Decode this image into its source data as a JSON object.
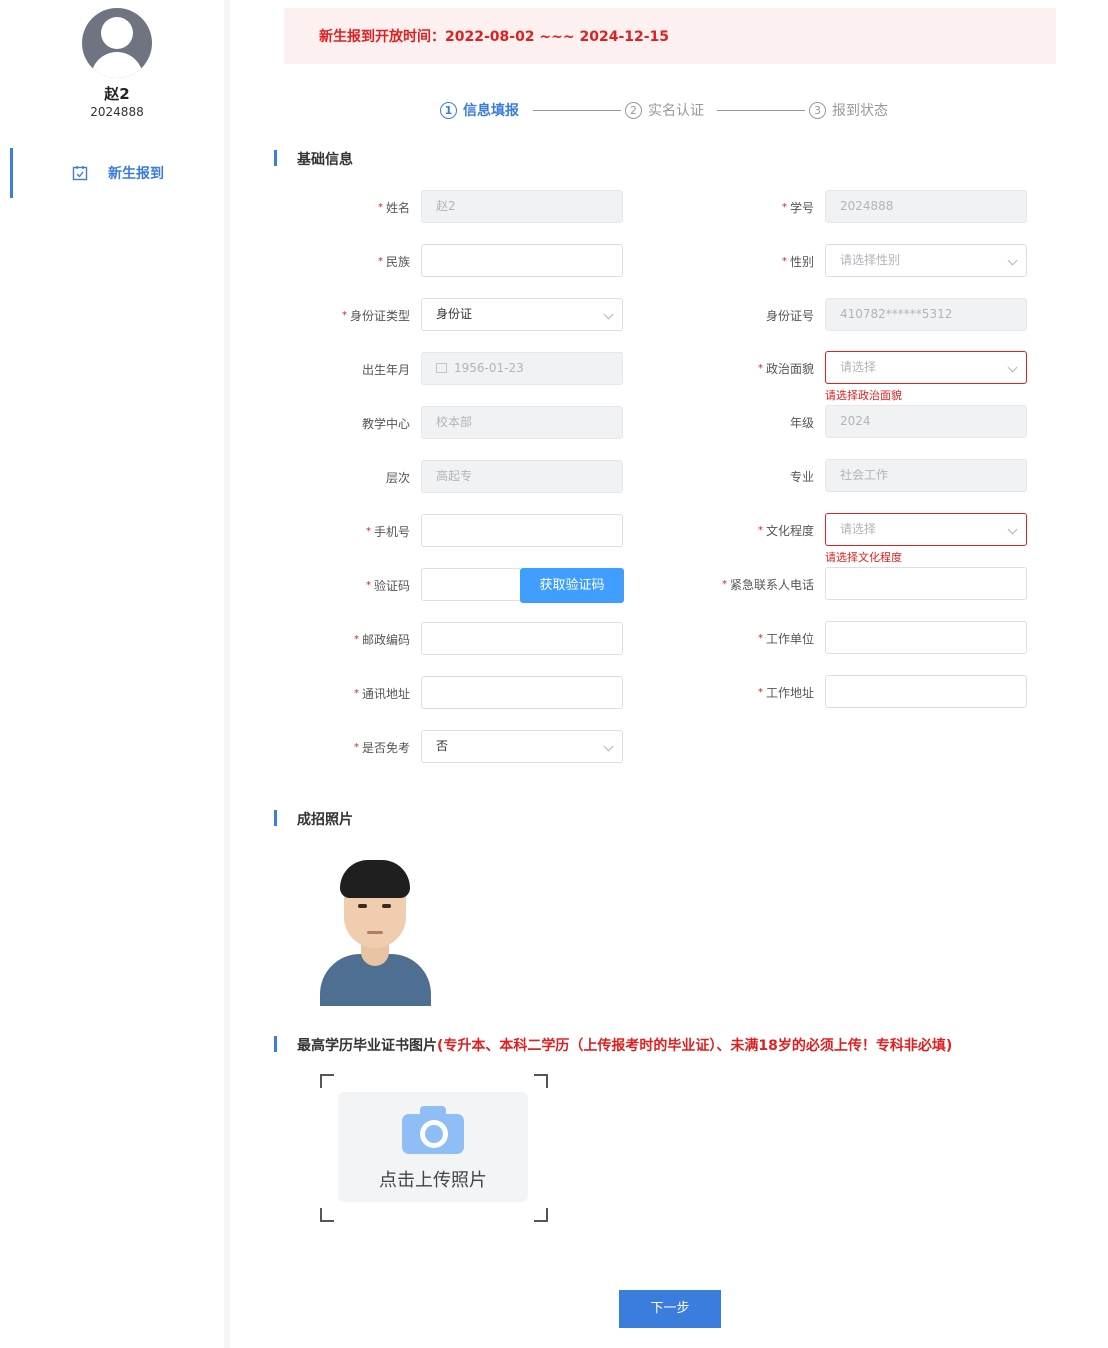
{
  "user": {
    "name": "赵2",
    "id": "2024888"
  },
  "nav": {
    "item_label": "新生报到"
  },
  "notice": {
    "text": "新生报到开放时间：2022-08-02 ~~~ 2024-12-15"
  },
  "steps": [
    {
      "num": "1",
      "label": "信息填报"
    },
    {
      "num": "2",
      "label": "实名认证"
    },
    {
      "num": "3",
      "label": "报到状态"
    }
  ],
  "sections": {
    "basic": "基础信息",
    "photo": "成招照片",
    "diploma_prefix": "最高学历毕业证书图片",
    "diploma_note": "(专升本、本科二学历（上传报考时的毕业证）、未满18岁的必须上传！专科非必填)"
  },
  "form": {
    "name": {
      "label": "姓名",
      "value": "赵2"
    },
    "student_no": {
      "label": "学号",
      "value": "2024888"
    },
    "ethnicity": {
      "label": "民族",
      "value": ""
    },
    "gender": {
      "label": "性别",
      "placeholder": "请选择性别"
    },
    "id_type": {
      "label": "身份证类型",
      "value": "身份证"
    },
    "id_no": {
      "label": "身份证号",
      "value": "410782******5312"
    },
    "birth": {
      "label": "出生年月",
      "value": "1956-01-23"
    },
    "political": {
      "label": "政治面貌",
      "placeholder": "请选择",
      "error": "请选择政治面貌"
    },
    "center": {
      "label": "教学中心",
      "value": "校本部"
    },
    "grade": {
      "label": "年级",
      "value": "2024"
    },
    "level": {
      "label": "层次",
      "value": "高起专"
    },
    "major": {
      "label": "专业",
      "value": "社会工作"
    },
    "phone": {
      "label": "手机号",
      "value": ""
    },
    "education": {
      "label": "文化程度",
      "placeholder": "请选择",
      "error": "请选择文化程度"
    },
    "code": {
      "label": "验证码",
      "value": "",
      "button": "获取验证码"
    },
    "emergency": {
      "label": "紧急联系人电话",
      "value": ""
    },
    "postcode": {
      "label": "邮政编码",
      "value": ""
    },
    "work_unit": {
      "label": "工作单位",
      "value": ""
    },
    "address": {
      "label": "通讯地址",
      "value": ""
    },
    "work_address": {
      "label": "工作地址",
      "value": ""
    },
    "exempt": {
      "label": "是否免考",
      "value": "否"
    }
  },
  "upload": {
    "text": "点击上传照片"
  },
  "next_button": "下一步",
  "colors": {
    "accent": "#3b7ddd",
    "error": "#e02020",
    "notice_bg": "#fdf0f0"
  }
}
